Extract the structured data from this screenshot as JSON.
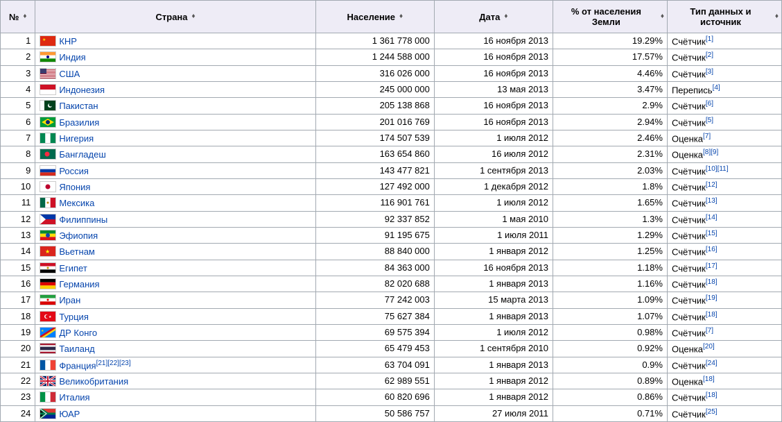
{
  "headers": {
    "rank": "№",
    "country": "Страна",
    "population": "Население",
    "date": "Дата",
    "percent": "% от населения Земли",
    "source": "Тип данных и источник"
  },
  "rows": [
    {
      "rank": "1",
      "country": "КНР",
      "population": "1 361 778 000",
      "date": "16 ноября 2013",
      "percent": "19.29%",
      "source": "Счётчик",
      "refs": [
        "[1]"
      ],
      "country_refs": [],
      "flag": "cn"
    },
    {
      "rank": "2",
      "country": "Индия",
      "population": "1 244 588 000",
      "date": "16 ноября 2013",
      "percent": "17.57%",
      "source": "Счётчик",
      "refs": [
        "[2]"
      ],
      "country_refs": [],
      "flag": "in"
    },
    {
      "rank": "3",
      "country": "США",
      "population": "316 026 000",
      "date": "16 ноября 2013",
      "percent": "4.46%",
      "source": "Счётчик",
      "refs": [
        "[3]"
      ],
      "country_refs": [],
      "flag": "us"
    },
    {
      "rank": "4",
      "country": "Индонезия",
      "population": "245 000 000",
      "date": "13 мая 2013",
      "percent": "3.47%",
      "source": "Перепись",
      "refs": [
        "[4]"
      ],
      "country_refs": [],
      "flag": "id"
    },
    {
      "rank": "5",
      "country": "Пакистан",
      "population": "205 138 868",
      "date": "16 ноября 2013",
      "percent": "2.9%",
      "source": "Счётчик",
      "refs": [
        "[6]"
      ],
      "country_refs": [],
      "flag": "pk"
    },
    {
      "rank": "6",
      "country": "Бразилия",
      "population": "201 016 769",
      "date": "16 ноября 2013",
      "percent": "2.94%",
      "source": "Счётчик",
      "refs": [
        "[5]"
      ],
      "country_refs": [],
      "flag": "br"
    },
    {
      "rank": "7",
      "country": "Нигерия",
      "population": "174 507 539",
      "date": "1 июля 2012",
      "percent": "2.46%",
      "source": "Оценка",
      "refs": [
        "[7]"
      ],
      "country_refs": [],
      "flag": "ng"
    },
    {
      "rank": "8",
      "country": "Бангладеш",
      "population": "163 654 860",
      "date": "16 июля 2012",
      "percent": "2.31%",
      "source": "Оценка",
      "refs": [
        "[8]",
        "[9]"
      ],
      "country_refs": [],
      "flag": "bd"
    },
    {
      "rank": "9",
      "country": "Россия",
      "population": "143 477 821",
      "date": "1 сентября 2013",
      "percent": "2.03%",
      "source": "Счётчик",
      "refs": [
        "[10]",
        "[11]"
      ],
      "country_refs": [],
      "flag": "ru"
    },
    {
      "rank": "10",
      "country": "Япония",
      "population": "127 492 000",
      "date": "1 декабря 2012",
      "percent": "1.8%",
      "source": "Счётчик",
      "refs": [
        "[12]"
      ],
      "country_refs": [],
      "flag": "jp"
    },
    {
      "rank": "11",
      "country": "Мексика",
      "population": "116 901 761",
      "date": "1 июля 2012",
      "percent": "1.65%",
      "source": "Счётчик",
      "refs": [
        "[13]"
      ],
      "country_refs": [],
      "flag": "mx"
    },
    {
      "rank": "12",
      "country": "Филиппины",
      "population": "92 337 852",
      "date": "1 мая 2010",
      "percent": "1.3%",
      "source": "Счётчик",
      "refs": [
        "[14]"
      ],
      "country_refs": [],
      "flag": "ph"
    },
    {
      "rank": "13",
      "country": "Эфиопия",
      "population": "91 195 675",
      "date": "1 июля 2011",
      "percent": "1.29%",
      "source": "Счётчик",
      "refs": [
        "[15]"
      ],
      "country_refs": [],
      "flag": "et"
    },
    {
      "rank": "14",
      "country": "Вьетнам",
      "population": "88 840 000",
      "date": "1 января 2012",
      "percent": "1.25%",
      "source": "Счётчик",
      "refs": [
        "[16]"
      ],
      "country_refs": [],
      "flag": "vn"
    },
    {
      "rank": "15",
      "country": "Египет",
      "population": "84 363 000",
      "date": "16 ноября 2013",
      "percent": "1.18%",
      "source": "Счётчик",
      "refs": [
        "[17]"
      ],
      "country_refs": [],
      "flag": "eg"
    },
    {
      "rank": "16",
      "country": "Германия",
      "population": "82 020 688",
      "date": "1 января 2013",
      "percent": "1.16%",
      "source": "Счётчик",
      "refs": [
        "[18]"
      ],
      "country_refs": [],
      "flag": "de"
    },
    {
      "rank": "17",
      "country": "Иран",
      "population": "77 242 003",
      "date": "15 марта 2013",
      "percent": "1.09%",
      "source": "Счётчик",
      "refs": [
        "[19]"
      ],
      "country_refs": [],
      "flag": "ir"
    },
    {
      "rank": "18",
      "country": "Турция",
      "population": "75 627 384",
      "date": "1 января 2013",
      "percent": "1.07%",
      "source": "Счётчик",
      "refs": [
        "[18]"
      ],
      "country_refs": [],
      "flag": "tr"
    },
    {
      "rank": "19",
      "country": "ДР Конго",
      "population": "69 575 394",
      "date": "1 июля 2012",
      "percent": "0.98%",
      "source": "Счётчик",
      "refs": [
        "[7]"
      ],
      "country_refs": [],
      "flag": "cd"
    },
    {
      "rank": "20",
      "country": "Таиланд",
      "population": "65 479 453",
      "date": "1 сентября 2010",
      "percent": "0.92%",
      "source": "Оценка",
      "refs": [
        "[20]"
      ],
      "country_refs": [],
      "flag": "th"
    },
    {
      "rank": "21",
      "country": "Франция",
      "population": "63 704 091",
      "date": "1 января 2013",
      "percent": "0.9%",
      "source": "Счётчик",
      "refs": [
        "[24]"
      ],
      "country_refs": [
        "[21]",
        "[22]",
        "[23]"
      ],
      "flag": "fr"
    },
    {
      "rank": "22",
      "country": "Великобритания",
      "population": "62 989 551",
      "date": "1 января 2012",
      "percent": "0.89%",
      "source": "Оценка",
      "refs": [
        "[18]"
      ],
      "country_refs": [],
      "flag": "gb"
    },
    {
      "rank": "23",
      "country": "Италия",
      "population": "60 820 696",
      "date": "1 января 2012",
      "percent": "0.86%",
      "source": "Счётчик",
      "refs": [
        "[18]"
      ],
      "country_refs": [],
      "flag": "it"
    },
    {
      "rank": "24",
      "country": "ЮАР",
      "population": "50 586 757",
      "date": "27 июля 2011",
      "percent": "0.71%",
      "source": "Счётчик",
      "refs": [
        "[25]"
      ],
      "country_refs": [],
      "flag": "za"
    }
  ]
}
